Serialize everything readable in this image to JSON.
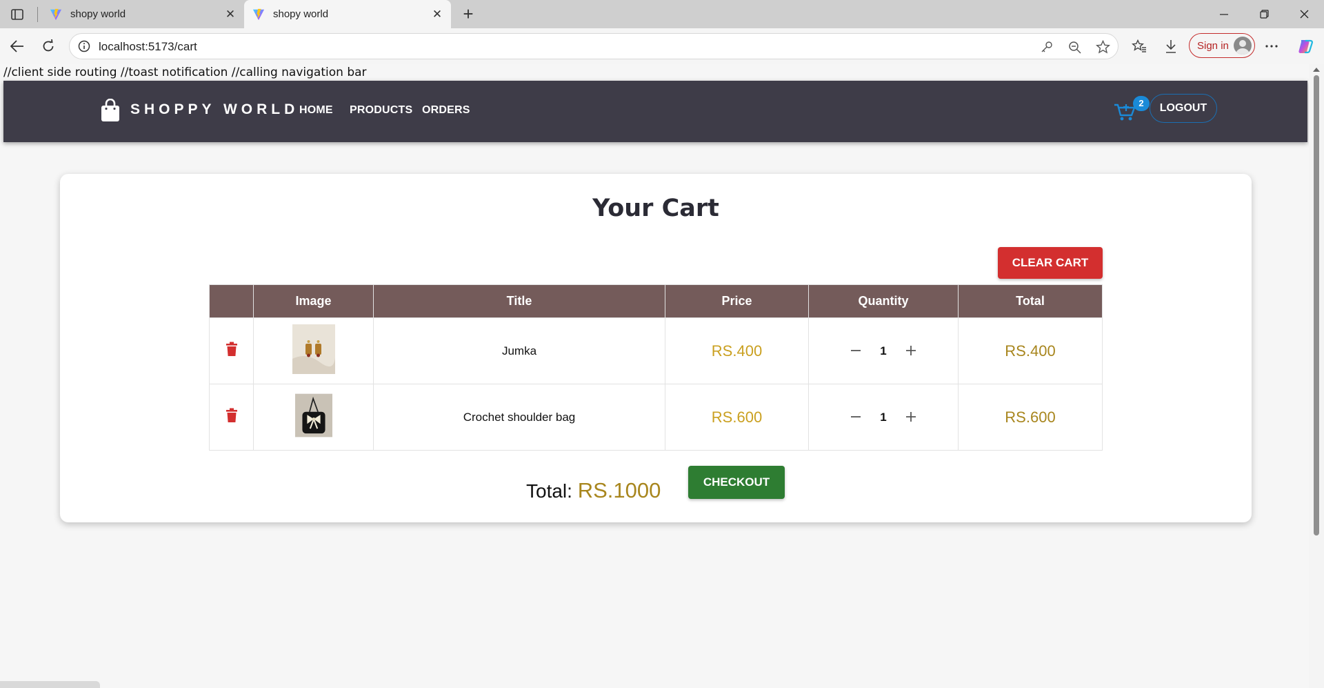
{
  "browser": {
    "tabs": [
      {
        "title": "shopy world",
        "close": "✕"
      },
      {
        "title": "shopy world",
        "close": "✕"
      }
    ],
    "new_tab": "+",
    "url": "localhost:5173/cart",
    "sign_in": "Sign in",
    "window_controls": {
      "minimize": "—",
      "restore": "❐",
      "close": "✕"
    }
  },
  "dev_note": "//client side routing //toast notification //calling navigation bar",
  "navbar": {
    "brand": "SHOPPY WORLD",
    "links": [
      "HOME",
      "PRODUCTS",
      "ORDERS"
    ],
    "cart_count": "2",
    "logout": "LOGOUT"
  },
  "cart": {
    "title": "Your Cart",
    "clear_label": "CLEAR CART",
    "columns": [
      "",
      "Image",
      "Title",
      "Price",
      "Quantity",
      "Total"
    ],
    "items": [
      {
        "title": "Jumka",
        "price": "RS.400",
        "quantity": "1",
        "total": "RS.400",
        "image_icon": "earring-image"
      },
      {
        "title": "Crochet shoulder bag",
        "price": "RS.600",
        "quantity": "1",
        "total": "RS.600",
        "image_icon": "bag-image"
      }
    ],
    "total_label": "Total:",
    "total_value": "RS.1000",
    "checkout_label": "CHECKOUT"
  },
  "colors": {
    "navbar_bg": "#3e3c48",
    "table_header": "#745b5a",
    "clear_button": "#d32f2f",
    "checkout_button": "#2e7d32",
    "price_gold": "#caa020",
    "cart_badge": "#1a8ad8"
  }
}
